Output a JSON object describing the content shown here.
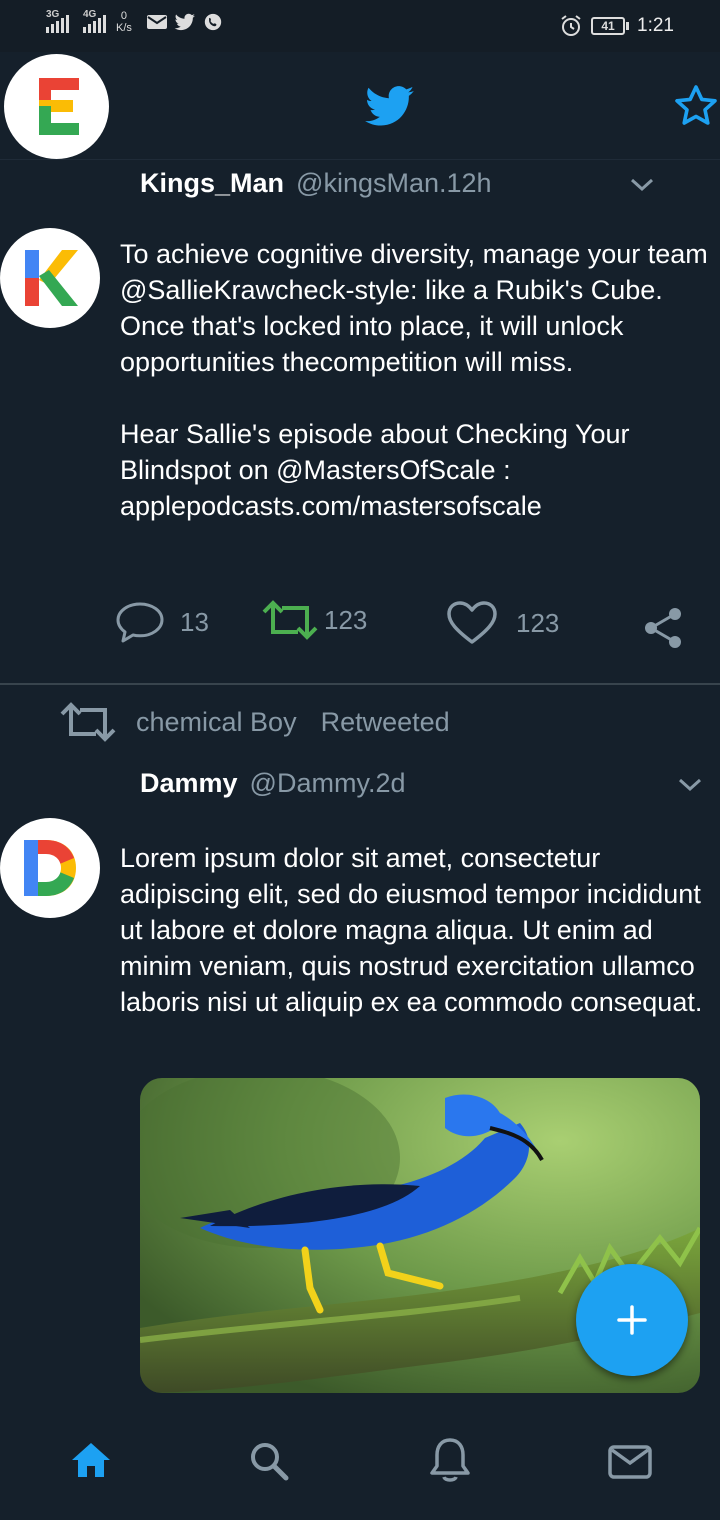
{
  "status": {
    "net1": "3G",
    "net2": "4G",
    "speed_value": "0",
    "speed_unit": "K/s",
    "battery": "41",
    "time": "1:21"
  },
  "header": {
    "profile_icon": "profile-avatar-E",
    "logo_icon": "twitter-bird-icon",
    "star_icon": "star-outline-icon"
  },
  "tweets": [
    {
      "name": "Kings_Man",
      "handle": "@kingsMan.12h",
      "avatar_letter": "K",
      "text": "To achieve cognitive diversity, manage your team @SallieKrawcheck-style: like a Rubik's Cube. Once that's locked into place, it will unlock opportunities thecompetition will miss.\n\nHear Sallie's episode about Checking Your Blindspot on @MastersOfScale :\napplepodcasts.com/mastersofscale",
      "replies": "13",
      "retweets": "123",
      "likes": "123"
    },
    {
      "retweeted_by": "chemical Boy",
      "retweeted_label": "Retweeted",
      "name": "Dammy",
      "handle": "@Dammy.2d",
      "avatar_letter": "D",
      "text": "Lorem ipsum dolor sit amet, consectetur adipiscing elit, sed do eiusmod tempor incididunt ut labore et dolore magna aliqua. Ut enim ad minim veniam, quis nostrud exercitation ullamco laboris nisi ut aliquip ex ea commodo consequat.",
      "media": "bird-photo"
    }
  ],
  "nav": [
    "home-icon",
    "search-icon",
    "notifications-icon",
    "messages-icon"
  ],
  "colors": {
    "background": "#15202b",
    "accent": "#1da1f2",
    "muted": "#8899a6",
    "retweet_green": "#4caf50"
  }
}
